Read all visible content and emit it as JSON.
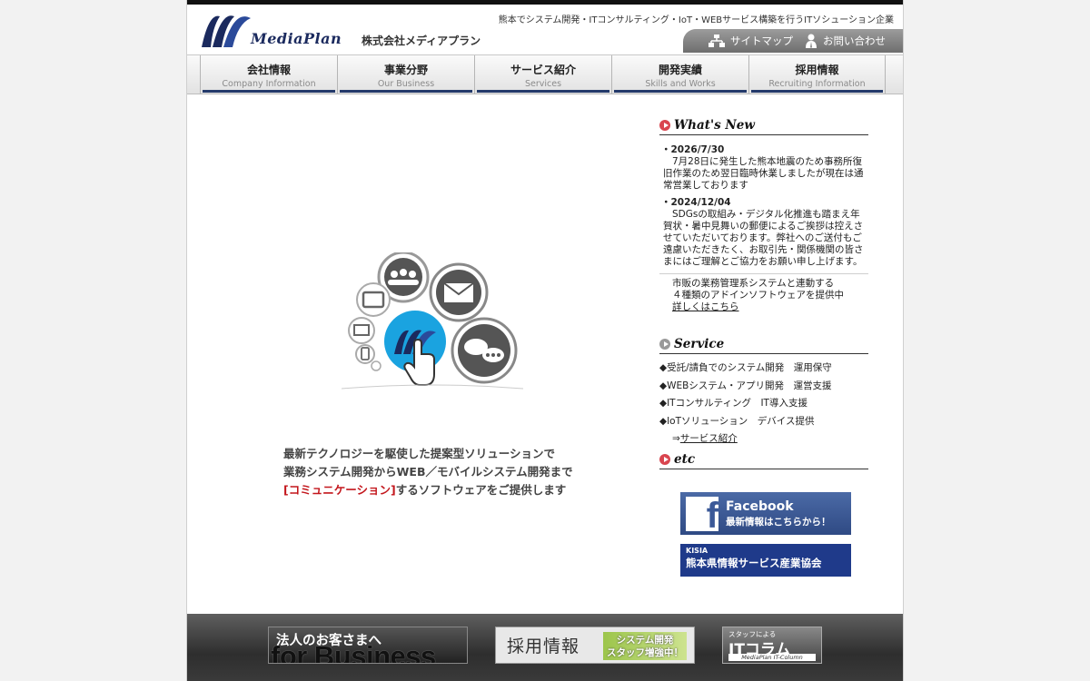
{
  "header": {
    "logo_text": "MediaPlan",
    "company_name": "株式会社メディアプラン",
    "tagline": "熊本でシステム開発・ITコンサルティング・IoT・WEBサービス構築を行うITソシューション企業",
    "utility": [
      {
        "label": "サイトマップ",
        "icon": "sitemap-icon"
      },
      {
        "label": "お問い合わせ",
        "icon": "contact-person-icon"
      }
    ]
  },
  "nav": [
    {
      "jp": "会社情報",
      "en": "Company Information"
    },
    {
      "jp": "事業分野",
      "en": "Our Business"
    },
    {
      "jp": "サービス紹介",
      "en": "Services"
    },
    {
      "jp": "開発実績",
      "en": "Skills and Works"
    },
    {
      "jp": "採用情報",
      "en": "Recruiting Information"
    }
  ],
  "hero": {
    "line1": "最新テクノロジーを駆使した提案型ソリューションで",
    "line2": "業務システム開発からWEB／モバイルシステム開発まで",
    "line3_highlight": "[コミュニケーション]",
    "line3_rest": "するソフトウェアをご提供します"
  },
  "whats_new": {
    "title": "What's New",
    "items": [
      {
        "date": "・2026/7/30",
        "body": "7月28日に発生した熊本地震のため事務所復旧作業のため翌日臨時休業しましたが現在は通常営業しております"
      },
      {
        "date": "・2024/12/04",
        "body": "SDGsの取組み・デジタル化推進も踏まえ年賀状・暑中見舞いの郵便によるご挨拶は控えさせていただいております。弊社へのご送付もご遠慮いただきたく、お取引先・関係機関の皆さまにはご理解とご協力をお願い申し上げます。"
      }
    ],
    "promo_line1": "市販の業務管理系システムと連動する",
    "promo_line2": "４種類のアドインソフトウェアを提供中",
    "promo_link": "詳しくはこちら"
  },
  "service": {
    "title": "Service",
    "items": [
      "◆受託/請負でのシステム開発　運用保守",
      "◆WEBシステム・アプリ開発　運営支援",
      "◆ITコンサルティング　IT導入支援",
      "◆IoTソリューション　デバイス提供"
    ],
    "link_prefix": "⇒",
    "link_label": "サービス紹介"
  },
  "etc": {
    "title": "etc",
    "facebook_title": "Facebook",
    "facebook_sub": "最新情報はこちらから！",
    "kisia_abbr": "KISIA",
    "kisia_name": "熊本県情報サービス産業協会"
  },
  "footer": {
    "business_jp": "法人のお客さまへ",
    "business_en": "for Business",
    "recruit": "採用情報",
    "recruit_badge_line1": "システム開発",
    "recruit_badge_line2": "スタッフ増強中！",
    "column_small": "スタッフによる",
    "column_title": "ITコラム",
    "column_sub": "MediaPlan IT-Column"
  },
  "colors": {
    "navy": "#243a6b",
    "highlight_red": "#c3161c",
    "hero_blue": "#1aa3e0",
    "facebook_blue": "#3b5998",
    "kisia_blue": "#1f3a8a",
    "head_dot_red": "#d9454f",
    "head_dot_gray": "#999999"
  }
}
